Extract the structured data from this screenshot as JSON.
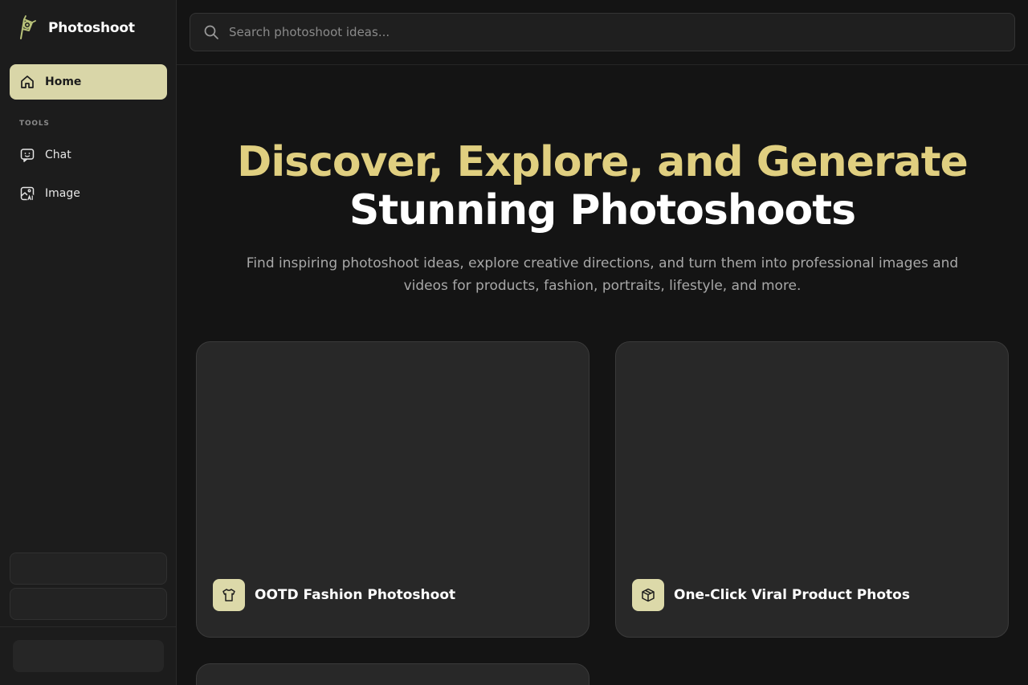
{
  "app": {
    "name": "Photoshoot"
  },
  "sidebar": {
    "home": {
      "label": "Home",
      "icon": "home-icon"
    },
    "tools_label": "TOOLS",
    "tools": [
      {
        "label": "Chat",
        "icon": "chat-icon"
      },
      {
        "label": "Image",
        "icon": "image-ai-icon"
      }
    ]
  },
  "search": {
    "placeholder": "Search photoshoot ideas...",
    "value": ""
  },
  "hero": {
    "title_accent": "Discover, Explore, and Generate",
    "title_main": "Stunning Photoshoots",
    "subtitle": "Find inspiring photoshoot ideas, explore creative directions, and turn them into professional images and videos for products, fashion, portraits, lifestyle, and more."
  },
  "cards": [
    {
      "title": "OOTD Fashion Photoshoot",
      "icon": "tshirt-icon"
    },
    {
      "title": "One-Click Viral Product Photos",
      "icon": "box-icon"
    }
  ],
  "colors": {
    "accent": "#e0cf80",
    "active_nav": "#d9d6a8",
    "background": "#141414",
    "sidebar": "#1c1c1c",
    "card": "#282828"
  }
}
